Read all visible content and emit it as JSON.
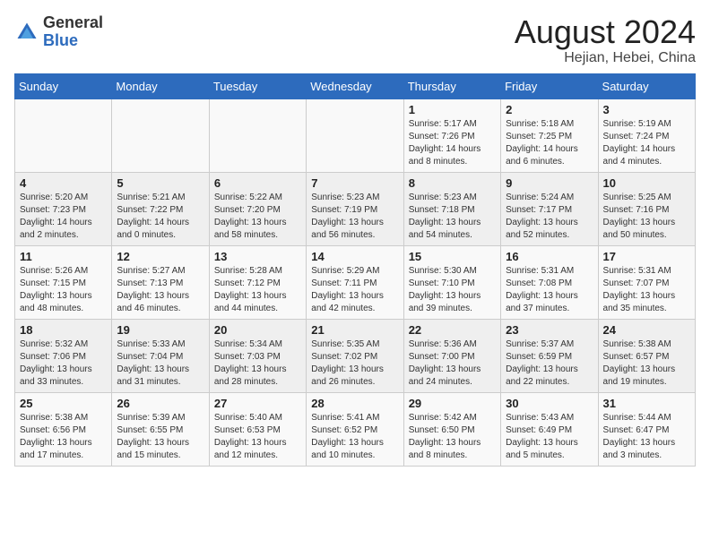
{
  "header": {
    "logo_general": "General",
    "logo_blue": "Blue",
    "month_year": "August 2024",
    "location": "Hejian, Hebei, China"
  },
  "weekdays": [
    "Sunday",
    "Monday",
    "Tuesday",
    "Wednesday",
    "Thursday",
    "Friday",
    "Saturday"
  ],
  "weeks": [
    [
      {
        "day": "",
        "info": ""
      },
      {
        "day": "",
        "info": ""
      },
      {
        "day": "",
        "info": ""
      },
      {
        "day": "",
        "info": ""
      },
      {
        "day": "1",
        "info": "Sunrise: 5:17 AM\nSunset: 7:26 PM\nDaylight: 14 hours\nand 8 minutes."
      },
      {
        "day": "2",
        "info": "Sunrise: 5:18 AM\nSunset: 7:25 PM\nDaylight: 14 hours\nand 6 minutes."
      },
      {
        "day": "3",
        "info": "Sunrise: 5:19 AM\nSunset: 7:24 PM\nDaylight: 14 hours\nand 4 minutes."
      }
    ],
    [
      {
        "day": "4",
        "info": "Sunrise: 5:20 AM\nSunset: 7:23 PM\nDaylight: 14 hours\nand 2 minutes."
      },
      {
        "day": "5",
        "info": "Sunrise: 5:21 AM\nSunset: 7:22 PM\nDaylight: 14 hours\nand 0 minutes."
      },
      {
        "day": "6",
        "info": "Sunrise: 5:22 AM\nSunset: 7:20 PM\nDaylight: 13 hours\nand 58 minutes."
      },
      {
        "day": "7",
        "info": "Sunrise: 5:23 AM\nSunset: 7:19 PM\nDaylight: 13 hours\nand 56 minutes."
      },
      {
        "day": "8",
        "info": "Sunrise: 5:23 AM\nSunset: 7:18 PM\nDaylight: 13 hours\nand 54 minutes."
      },
      {
        "day": "9",
        "info": "Sunrise: 5:24 AM\nSunset: 7:17 PM\nDaylight: 13 hours\nand 52 minutes."
      },
      {
        "day": "10",
        "info": "Sunrise: 5:25 AM\nSunset: 7:16 PM\nDaylight: 13 hours\nand 50 minutes."
      }
    ],
    [
      {
        "day": "11",
        "info": "Sunrise: 5:26 AM\nSunset: 7:15 PM\nDaylight: 13 hours\nand 48 minutes."
      },
      {
        "day": "12",
        "info": "Sunrise: 5:27 AM\nSunset: 7:13 PM\nDaylight: 13 hours\nand 46 minutes."
      },
      {
        "day": "13",
        "info": "Sunrise: 5:28 AM\nSunset: 7:12 PM\nDaylight: 13 hours\nand 44 minutes."
      },
      {
        "day": "14",
        "info": "Sunrise: 5:29 AM\nSunset: 7:11 PM\nDaylight: 13 hours\nand 42 minutes."
      },
      {
        "day": "15",
        "info": "Sunrise: 5:30 AM\nSunset: 7:10 PM\nDaylight: 13 hours\nand 39 minutes."
      },
      {
        "day": "16",
        "info": "Sunrise: 5:31 AM\nSunset: 7:08 PM\nDaylight: 13 hours\nand 37 minutes."
      },
      {
        "day": "17",
        "info": "Sunrise: 5:31 AM\nSunset: 7:07 PM\nDaylight: 13 hours\nand 35 minutes."
      }
    ],
    [
      {
        "day": "18",
        "info": "Sunrise: 5:32 AM\nSunset: 7:06 PM\nDaylight: 13 hours\nand 33 minutes."
      },
      {
        "day": "19",
        "info": "Sunrise: 5:33 AM\nSunset: 7:04 PM\nDaylight: 13 hours\nand 31 minutes."
      },
      {
        "day": "20",
        "info": "Sunrise: 5:34 AM\nSunset: 7:03 PM\nDaylight: 13 hours\nand 28 minutes."
      },
      {
        "day": "21",
        "info": "Sunrise: 5:35 AM\nSunset: 7:02 PM\nDaylight: 13 hours\nand 26 minutes."
      },
      {
        "day": "22",
        "info": "Sunrise: 5:36 AM\nSunset: 7:00 PM\nDaylight: 13 hours\nand 24 minutes."
      },
      {
        "day": "23",
        "info": "Sunrise: 5:37 AM\nSunset: 6:59 PM\nDaylight: 13 hours\nand 22 minutes."
      },
      {
        "day": "24",
        "info": "Sunrise: 5:38 AM\nSunset: 6:57 PM\nDaylight: 13 hours\nand 19 minutes."
      }
    ],
    [
      {
        "day": "25",
        "info": "Sunrise: 5:38 AM\nSunset: 6:56 PM\nDaylight: 13 hours\nand 17 minutes."
      },
      {
        "day": "26",
        "info": "Sunrise: 5:39 AM\nSunset: 6:55 PM\nDaylight: 13 hours\nand 15 minutes."
      },
      {
        "day": "27",
        "info": "Sunrise: 5:40 AM\nSunset: 6:53 PM\nDaylight: 13 hours\nand 12 minutes."
      },
      {
        "day": "28",
        "info": "Sunrise: 5:41 AM\nSunset: 6:52 PM\nDaylight: 13 hours\nand 10 minutes."
      },
      {
        "day": "29",
        "info": "Sunrise: 5:42 AM\nSunset: 6:50 PM\nDaylight: 13 hours\nand 8 minutes."
      },
      {
        "day": "30",
        "info": "Sunrise: 5:43 AM\nSunset: 6:49 PM\nDaylight: 13 hours\nand 5 minutes."
      },
      {
        "day": "31",
        "info": "Sunrise: 5:44 AM\nSunset: 6:47 PM\nDaylight: 13 hours\nand 3 minutes."
      }
    ]
  ]
}
